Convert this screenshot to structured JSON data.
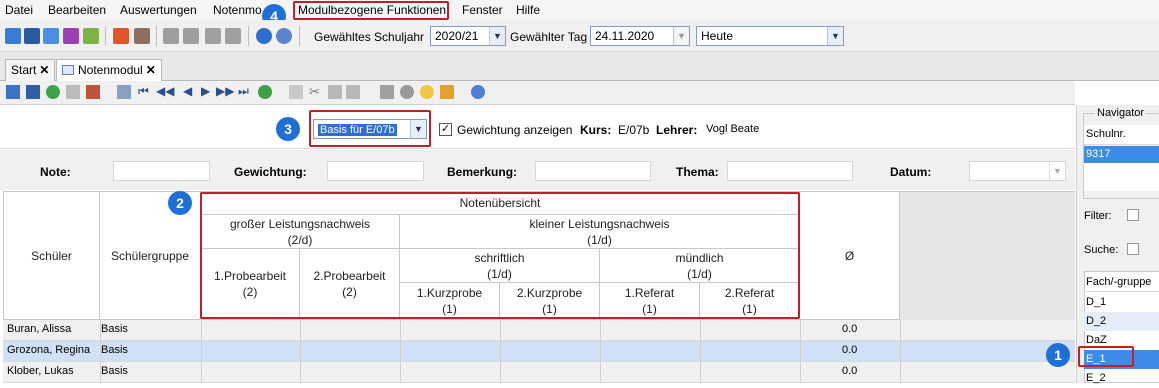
{
  "menu": {
    "items": [
      {
        "label": "Datei"
      },
      {
        "label": "Bearbeiten"
      },
      {
        "label": "Auswertungen"
      },
      {
        "label": "Notenmo"
      },
      {
        "label": "Modulbezogene Funktionen"
      },
      {
        "label": "Fenster"
      },
      {
        "label": "Hilfe"
      }
    ]
  },
  "toolbar": {
    "schuljahr_label": "Gewähltes Schuljahr",
    "schuljahr_value": "2020/21",
    "tag_label": "Gewählter Tag",
    "tag_value": "24.11.2020",
    "heute_value": "Heute"
  },
  "tabs": [
    {
      "label": "Start"
    },
    {
      "label": "Notenmodul"
    }
  ],
  "filter": {
    "combo_value": "Basis für E/07b",
    "checkbox_label": "Gewichtung anzeigen",
    "kurs_label": "Kurs:",
    "kurs_value": "E/07b",
    "lehrer_label": "Lehrer:",
    "lehrer_value": "Vogl Beate"
  },
  "fields": {
    "note": "Note:",
    "gewichtung": "Gewichtung:",
    "bemerkung": "Bemerkung:",
    "thema": "Thema:",
    "datum": "Datum:"
  },
  "grid": {
    "col_schueler": "Schüler",
    "col_gruppe": "Schülergruppe",
    "notenuebersicht": "Notenübersicht",
    "gross": "großer Leistungsnachweis",
    "gross_w": "(2/d)",
    "klein": "kleiner Leistungsnachweis",
    "klein_w": "(1/d)",
    "schriftlich": "schriftlich",
    "schriftlich_w": "(1/d)",
    "muendlich": "mündlich",
    "muendlich_w": "(1/d)",
    "probe1": "1.Probearbeit",
    "probe1_w": "(2)",
    "probe2": "2.Probearbeit",
    "probe2_w": "(2)",
    "kurz1": "1.Kurzprobe",
    "kurz1_w": "(1)",
    "kurz2": "2.Kurzprobe",
    "kurz2_w": "(1)",
    "ref1": "1.Referat",
    "ref1_w": "(1)",
    "ref2": "2.Referat",
    "ref2_w": "(1)",
    "avg": "Ø",
    "rows": [
      {
        "name": "Buran, Alissa",
        "gruppe": "Basis",
        "avg": "0.0"
      },
      {
        "name": "Grozona, Regina",
        "gruppe": "Basis",
        "avg": "0.0"
      },
      {
        "name": "Klober, Lukas",
        "gruppe": "Basis",
        "avg": "0.0"
      }
    ]
  },
  "navigator": {
    "title": "Navigator",
    "schulnr_label": "Schulnr.",
    "schulnr_value": "9317",
    "filter_label": "Filter:",
    "suche_label": "Suche:",
    "fach_label": "Fach/-gruppe",
    "fach_items": [
      "D_1",
      "D_2",
      "DaZ",
      "E_1",
      "E_2"
    ]
  },
  "badges": [
    "1",
    "2",
    "3",
    "4"
  ],
  "colors": {
    "highlight_red": "#c0202a",
    "badge_blue": "#1e6fd6",
    "row_selected": "#cfe0f7",
    "nav_selected": "#3f8be8"
  }
}
